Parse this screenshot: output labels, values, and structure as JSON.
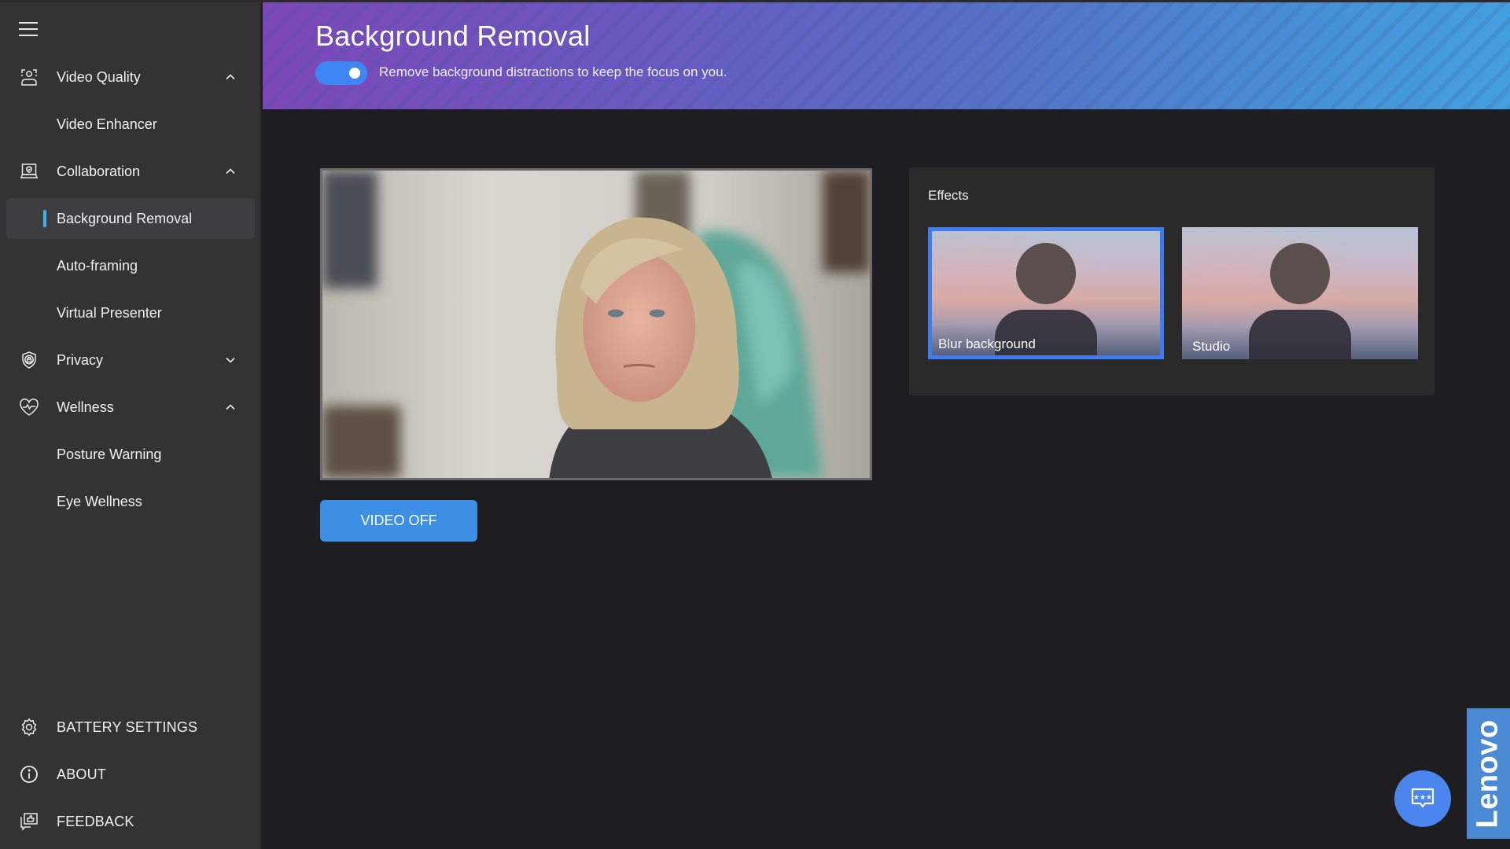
{
  "sidebar": {
    "menu_icon": "hamburger-icon",
    "sections": [
      {
        "label": "Video Quality",
        "icon": "camera-person-icon",
        "expanded": true,
        "children": [
          {
            "label": "Video Enhancer"
          }
        ]
      },
      {
        "label": "Collaboration",
        "icon": "laptop-shield-icon",
        "expanded": true,
        "children": [
          {
            "label": "Background Removal",
            "active": true
          },
          {
            "label": "Auto-framing"
          },
          {
            "label": "Virtual Presenter"
          }
        ]
      },
      {
        "label": "Privacy",
        "icon": "shield-lock-icon",
        "expanded": false,
        "children": []
      },
      {
        "label": "Wellness",
        "icon": "heart-pulse-icon",
        "expanded": true,
        "children": [
          {
            "label": "Posture Warning"
          },
          {
            "label": "Eye Wellness"
          }
        ]
      }
    ],
    "bottom": [
      {
        "label": "BATTERY SETTINGS",
        "icon": "gear-icon"
      },
      {
        "label": "ABOUT",
        "icon": "info-icon"
      },
      {
        "label": "FEEDBACK",
        "icon": "feedback-icon"
      }
    ]
  },
  "header": {
    "title": "Background Removal",
    "toggle_on": true,
    "description": "Remove background distractions to keep the focus on you."
  },
  "preview": {
    "video_off_label": "VIDEO OFF"
  },
  "effects": {
    "title": "Effects",
    "options": [
      {
        "label": "Blur background",
        "selected": true
      },
      {
        "label": "Studio",
        "selected": false
      }
    ]
  },
  "brand": {
    "name": "Lenovo"
  },
  "colors": {
    "accent": "#3f86f5",
    "active_marker": "#3fb4f5",
    "sidebar_bg": "#333334",
    "content_bg": "#1e1e20",
    "button_blue": "#3d8fe6",
    "brand_blue": "#4a89d3"
  }
}
